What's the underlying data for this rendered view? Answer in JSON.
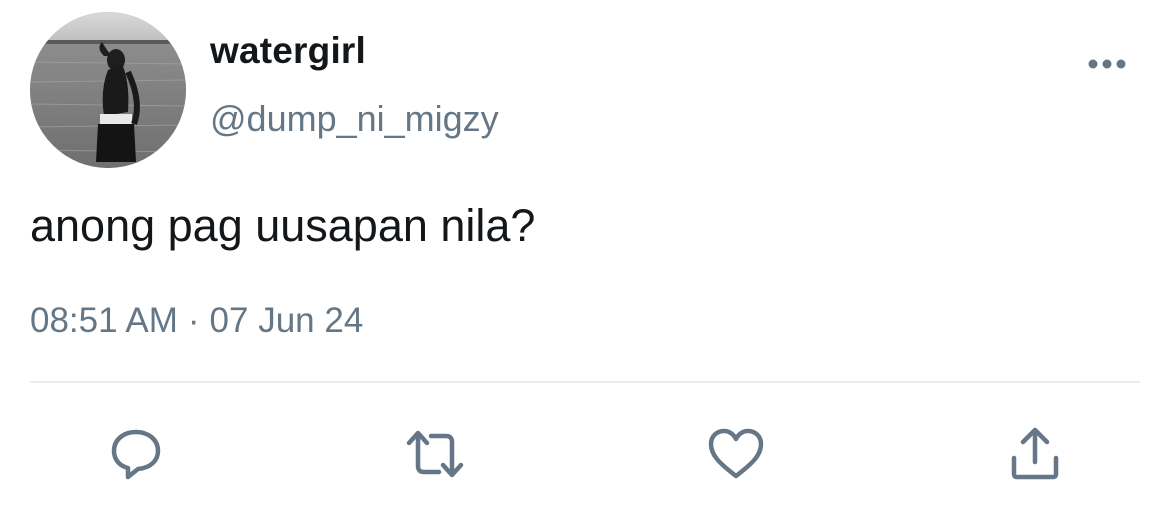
{
  "user": {
    "display_name": "watergirl",
    "handle": "@dump_ni_migzy",
    "avatar_icon": "profile-photo"
  },
  "tweet": {
    "text": "anong pag uusapan nila?",
    "time": "08:51 AM",
    "separator": "·",
    "date": "07 Jun 24"
  },
  "menu": {
    "icon": "more-horizontal-icon"
  },
  "actions": [
    {
      "name": "reply",
      "icon": "comment-bubble-icon"
    },
    {
      "name": "retweet",
      "icon": "retweet-icon"
    },
    {
      "name": "like",
      "icon": "heart-icon"
    },
    {
      "name": "share",
      "icon": "share-upload-icon"
    }
  ],
  "colors": {
    "text_primary": "#14171a",
    "text_secondary": "#657786",
    "icon": "#657786",
    "divider": "#e6ecf0",
    "background": "#ffffff"
  }
}
